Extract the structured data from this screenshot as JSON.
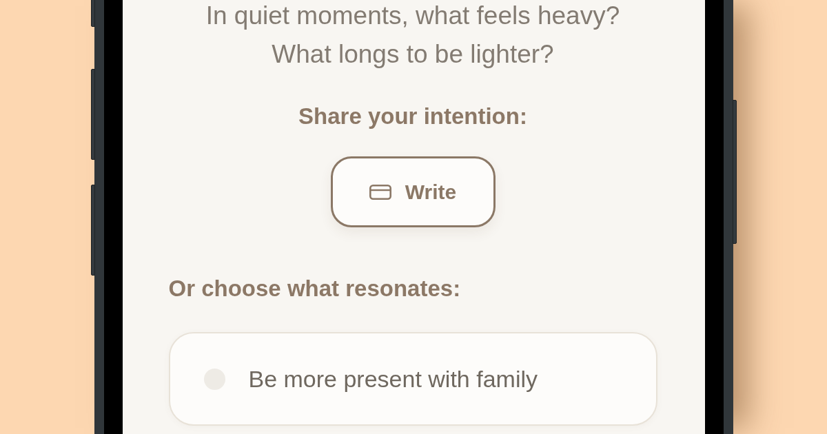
{
  "prompt": {
    "lines": [
      "In quiet moments, what feels heavy?",
      "What longs to be lighter?"
    ]
  },
  "intention": {
    "heading": "Share your intention:",
    "button": {
      "label": "Write"
    }
  },
  "choices": {
    "heading": "Or choose what resonates:",
    "options": [
      {
        "text": "Be more present with family",
        "selected": false
      }
    ]
  }
}
